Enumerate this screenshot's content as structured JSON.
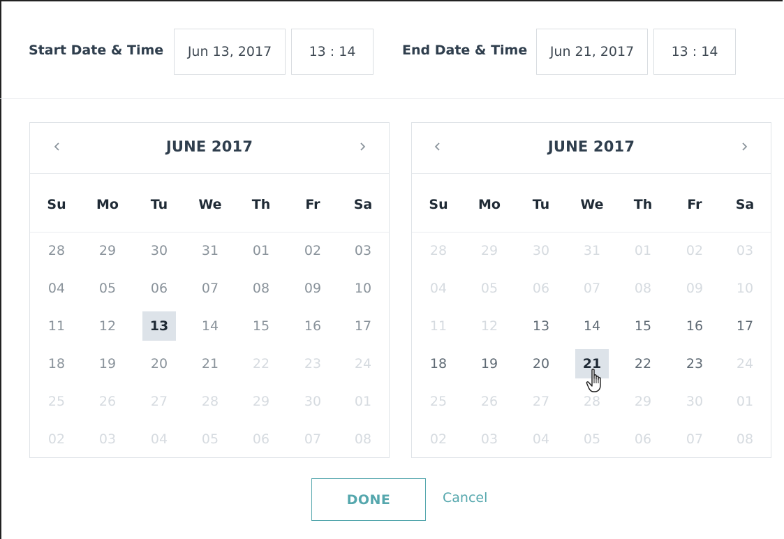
{
  "header": {
    "start_label": "Start Date & Time",
    "start_date": "Jun 13, 2017",
    "start_time": "13 : 14",
    "end_label": "End Date & Time",
    "end_date": "Jun 21, 2017",
    "end_time": "13 : 14"
  },
  "icons": {
    "prev": "chevron-left-icon",
    "next": "chevron-right-icon",
    "cursor": "hand-pointer-icon"
  },
  "calendars": [
    {
      "month": "JUNE 2017",
      "weekdays": [
        "Su",
        "Mo",
        "Tu",
        "We",
        "Th",
        "Fr",
        "Sa"
      ],
      "weeks": [
        [
          {
            "d": "28",
            "s": "in"
          },
          {
            "d": "29",
            "s": "in"
          },
          {
            "d": "30",
            "s": "in"
          },
          {
            "d": "31",
            "s": "in"
          },
          {
            "d": "01",
            "s": "in"
          },
          {
            "d": "02",
            "s": "in"
          },
          {
            "d": "03",
            "s": "in"
          }
        ],
        [
          {
            "d": "04",
            "s": "in"
          },
          {
            "d": "05",
            "s": "in"
          },
          {
            "d": "06",
            "s": "in"
          },
          {
            "d": "07",
            "s": "in"
          },
          {
            "d": "08",
            "s": "in"
          },
          {
            "d": "09",
            "s": "in"
          },
          {
            "d": "10",
            "s": "in"
          }
        ],
        [
          {
            "d": "11",
            "s": "in"
          },
          {
            "d": "12",
            "s": "in"
          },
          {
            "d": "13",
            "s": "sel"
          },
          {
            "d": "14",
            "s": "in"
          },
          {
            "d": "15",
            "s": "in"
          },
          {
            "d": "16",
            "s": "in"
          },
          {
            "d": "17",
            "s": "in"
          }
        ],
        [
          {
            "d": "18",
            "s": "in"
          },
          {
            "d": "19",
            "s": "in"
          },
          {
            "d": "20",
            "s": "in"
          },
          {
            "d": "21",
            "s": "in"
          },
          {
            "d": "22",
            "s": "out"
          },
          {
            "d": "23",
            "s": "out"
          },
          {
            "d": "24",
            "s": "out"
          }
        ],
        [
          {
            "d": "25",
            "s": "out"
          },
          {
            "d": "26",
            "s": "out"
          },
          {
            "d": "27",
            "s": "out"
          },
          {
            "d": "28",
            "s": "out"
          },
          {
            "d": "29",
            "s": "out"
          },
          {
            "d": "30",
            "s": "out"
          },
          {
            "d": "01",
            "s": "out"
          }
        ],
        [
          {
            "d": "02",
            "s": "out"
          },
          {
            "d": "03",
            "s": "out"
          },
          {
            "d": "04",
            "s": "out"
          },
          {
            "d": "05",
            "s": "out"
          },
          {
            "d": "06",
            "s": "out"
          },
          {
            "d": "07",
            "s": "out"
          },
          {
            "d": "08",
            "s": "out"
          }
        ]
      ]
    },
    {
      "month": "JUNE 2017",
      "weekdays": [
        "Su",
        "Mo",
        "Tu",
        "We",
        "Th",
        "Fr",
        "Sa"
      ],
      "weeks": [
        [
          {
            "d": "28",
            "s": "out"
          },
          {
            "d": "29",
            "s": "out"
          },
          {
            "d": "30",
            "s": "out"
          },
          {
            "d": "31",
            "s": "out"
          },
          {
            "d": "01",
            "s": "out"
          },
          {
            "d": "02",
            "s": "out"
          },
          {
            "d": "03",
            "s": "out"
          }
        ],
        [
          {
            "d": "04",
            "s": "out"
          },
          {
            "d": "05",
            "s": "out"
          },
          {
            "d": "06",
            "s": "out"
          },
          {
            "d": "07",
            "s": "out"
          },
          {
            "d": "08",
            "s": "out"
          },
          {
            "d": "09",
            "s": "out"
          },
          {
            "d": "10",
            "s": "out"
          }
        ],
        [
          {
            "d": "11",
            "s": "out"
          },
          {
            "d": "12",
            "s": "out"
          },
          {
            "d": "13",
            "s": "active"
          },
          {
            "d": "14",
            "s": "active"
          },
          {
            "d": "15",
            "s": "active"
          },
          {
            "d": "16",
            "s": "active"
          },
          {
            "d": "17",
            "s": "active"
          }
        ],
        [
          {
            "d": "18",
            "s": "active"
          },
          {
            "d": "19",
            "s": "active"
          },
          {
            "d": "20",
            "s": "active"
          },
          {
            "d": "21",
            "s": "sel"
          },
          {
            "d": "22",
            "s": "active"
          },
          {
            "d": "23",
            "s": "active"
          },
          {
            "d": "24",
            "s": "out"
          }
        ],
        [
          {
            "d": "25",
            "s": "out"
          },
          {
            "d": "26",
            "s": "out"
          },
          {
            "d": "27",
            "s": "out"
          },
          {
            "d": "28",
            "s": "out"
          },
          {
            "d": "29",
            "s": "out"
          },
          {
            "d": "30",
            "s": "out"
          },
          {
            "d": "01",
            "s": "out"
          }
        ],
        [
          {
            "d": "02",
            "s": "out"
          },
          {
            "d": "03",
            "s": "out"
          },
          {
            "d": "04",
            "s": "out"
          },
          {
            "d": "05",
            "s": "out"
          },
          {
            "d": "06",
            "s": "out"
          },
          {
            "d": "07",
            "s": "out"
          },
          {
            "d": "08",
            "s": "out"
          }
        ]
      ]
    }
  ],
  "footer": {
    "done_label": "DONE",
    "cancel_label": "Cancel"
  }
}
